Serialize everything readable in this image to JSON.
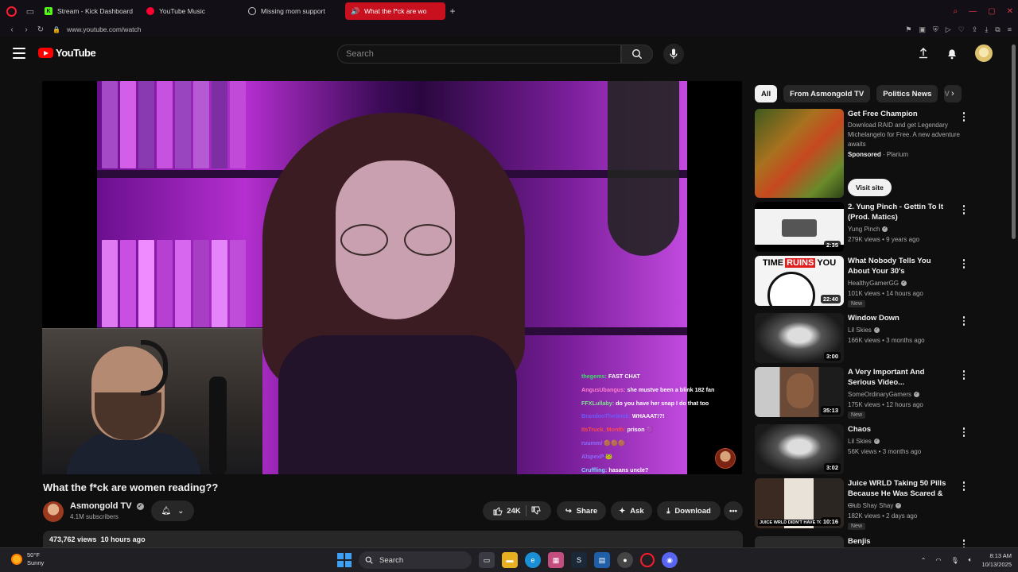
{
  "browser": {
    "tabs": [
      {
        "label": "Stream - Kick Dashboard",
        "icon": "kick-icon",
        "color": "#53fc18"
      },
      {
        "label": "YouTube Music",
        "icon": "youtube-music-icon",
        "color": "#ff0033"
      },
      {
        "label": "Missing mom support",
        "icon": "chat-icon",
        "color": "#cccccc"
      },
      {
        "label": "What the f*ck are wo",
        "icon": "speaker-icon",
        "color": "#ffffff",
        "active": true
      }
    ],
    "new_tab": "+",
    "url": "www.youtube.com/watch"
  },
  "youtube": {
    "logo_text": "YouTube",
    "search_placeholder": "Search"
  },
  "video": {
    "title": "What the f*ck are women reading??",
    "channel": "Asmongold TV",
    "subscribers": "4.1M subscribers",
    "likes": "24K",
    "share_label": "Share",
    "ask_label": "Ask",
    "download_label": "Download",
    "views": "473,762 views",
    "age": "10 hours ago"
  },
  "chat": [
    {
      "user": "thegems:",
      "msg": "FAST CHAT",
      "color": "#3fdc6a"
    },
    {
      "user": "AngusUbangus:",
      "msg": "she mustve been a blink 182 fan",
      "color": "#ff7fd0"
    },
    {
      "user": "FFXLullaby:",
      "msg": "do you have her snap I do that too",
      "color": "#7fe38f"
    },
    {
      "user": "BrandonTheSnek:",
      "msg": "WHAAAT!?!",
      "color": "#6b5cff"
    },
    {
      "user": "ItsTruck_Month:",
      "msg": "prison",
      "color": "#ff4a4a"
    },
    {
      "user": "ruumm/",
      "msg": "",
      "color": "#8a6cff"
    },
    {
      "user": "AlspexP",
      "msg": "",
      "color": "#8a6cff"
    },
    {
      "user": "Cruffling:",
      "msg": "hasans uncle?",
      "color": "#7fd0ff"
    }
  ],
  "sidebar": {
    "chips": [
      "All",
      "From Asmongold TV",
      "Politics News",
      "V"
    ],
    "ad": {
      "title": "Get Free Champion",
      "desc": "Download RAID and get Legendary Michelangelo for Free. A new adventure awaits",
      "sponsored": "Sponsored",
      "advertiser": "Plarium",
      "button": "Visit site"
    },
    "items": [
      {
        "title": "2. Yung Pinch - Gettin To It (Prod. Matics)",
        "channel": "Yung Pinch",
        "stats": "279K views • 9 years ago",
        "duration": "2:35",
        "new": ""
      },
      {
        "title": "What Nobody Tells You About Your 30's",
        "channel": "HealthyGamerGG",
        "stats": "101K views • 14 hours ago",
        "duration": "22:40",
        "new": "New"
      },
      {
        "title": "Window Down",
        "channel": "Lil Skies",
        "stats": "166K views • 3 months ago",
        "duration": "3:00",
        "new": ""
      },
      {
        "title": "A Very Important And Serious Video...",
        "channel": "SomeOrdinaryGamers",
        "stats": "175K views • 12 hours ago",
        "duration": "35:13",
        "new": "New"
      },
      {
        "title": "Chaos",
        "channel": "Lil Skies",
        "stats": "56K views • 3 months ago",
        "duration": "3:02",
        "new": ""
      },
      {
        "title": "Juice WRLD Taking 50 Pills Because He Was Scared & ...",
        "channel": "Club Shay Shay",
        "stats": "182K views • 2 days ago",
        "duration": "10:16",
        "new": "New"
      },
      {
        "title": "Benjis",
        "channel": "",
        "stats": "",
        "duration": "",
        "new": ""
      }
    ],
    "thumb_text_timeruins_1": "TIME",
    "thumb_text_timeruins_2": "RUINS",
    "thumb_text_timeruins_3": "YOU",
    "thumb_text_juice": "JUICE WRLD DIDN'T HAVE TO"
  },
  "taskbar": {
    "temp": "50°F",
    "weather": "Sunny",
    "search": "Search",
    "time": "8:13 AM",
    "date": "10/13/2025"
  }
}
